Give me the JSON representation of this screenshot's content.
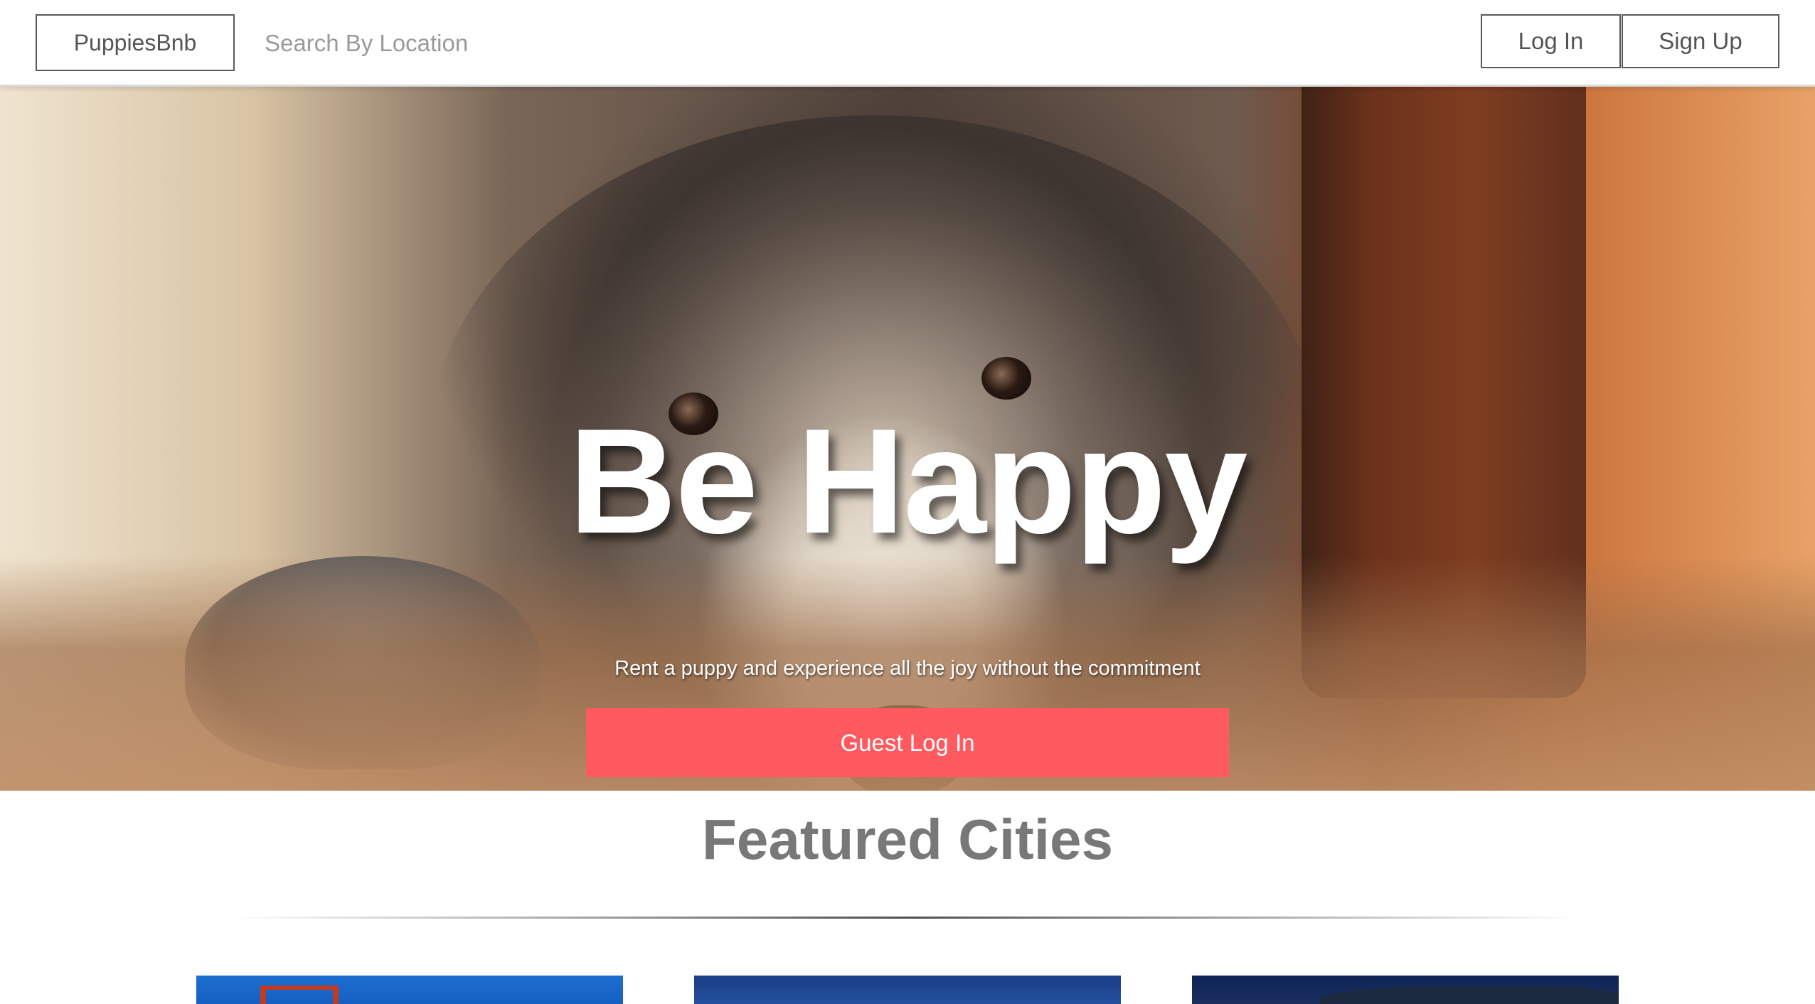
{
  "navbar": {
    "brand_label": "PuppiesBnb",
    "search_placeholder": "Search By Location",
    "login_label": "Log In",
    "signup_label": "Sign Up"
  },
  "hero": {
    "title": "Be Happy",
    "subtitle": "Rent a puppy and experience all the joy without the commitment",
    "guest_login_label": "Guest Log In"
  },
  "featured": {
    "title": "Featured Cities"
  },
  "colors": {
    "accent": "#ff5a5f",
    "heading_gray": "#787878",
    "border_gray": "#5a5a5a"
  }
}
